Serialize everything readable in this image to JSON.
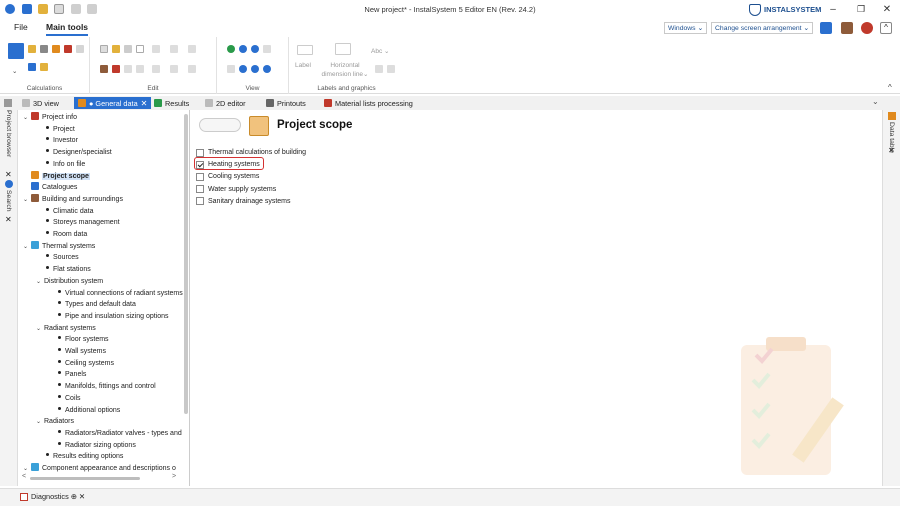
{
  "window": {
    "title": "New project* - InstalSystem 5 Editor EN (Rev. 24.2)",
    "brand": "INSTALSYSTEM",
    "minimize": "–",
    "restore": "❐",
    "close": "✕"
  },
  "menu": {
    "file": "File",
    "main_tools": "Main tools",
    "windows_select": "Windows ⌄",
    "arrangement_select": "Change screen arrangement ⌄"
  },
  "ribbon": {
    "groups": {
      "calculations": "Calculations",
      "edit": "Edit",
      "view": "View",
      "labels_graphics": "Labels and graphics"
    },
    "label_button": "Label",
    "horizontal_line_1": "Horizontal",
    "horizontal_line_2": "dimension line⌄",
    "abc": "Abc ⌄"
  },
  "tabs": [
    {
      "label": "3D view"
    },
    {
      "label": "● General data"
    },
    {
      "label": "Results"
    },
    {
      "label": "2D editor"
    },
    {
      "label": "Printouts"
    },
    {
      "label": "Material lists processing"
    }
  ],
  "side": {
    "left_1": "Project browser",
    "left_2": "Search",
    "right_1": "Data table"
  },
  "tree": [
    {
      "label": "Project info",
      "level": 0,
      "arrow": "⌄",
      "icon": "#c0392b"
    },
    {
      "label": "Project",
      "level": 1,
      "bullet": true
    },
    {
      "label": "Investor",
      "level": 1,
      "bullet": true
    },
    {
      "label": "Designer/specialist",
      "level": 1,
      "bullet": true
    },
    {
      "label": "Info on file",
      "level": 1,
      "bullet": true
    },
    {
      "label": "Project scope",
      "level": 0,
      "selected": true,
      "icon": "#e08a1e"
    },
    {
      "label": "Catalogues",
      "level": 0,
      "icon": "#2a6fcf"
    },
    {
      "label": "Building and surroundings",
      "level": 0,
      "arrow": "⌄",
      "icon": "#8e5b3a"
    },
    {
      "label": "Climatic data",
      "level": 1,
      "bullet": true
    },
    {
      "label": "Storeys management",
      "level": 1,
      "bullet": true
    },
    {
      "label": "Room data",
      "level": 1,
      "bullet": true
    },
    {
      "label": "Thermal systems",
      "level": 0,
      "arrow": "⌄",
      "icon": "#3aa0d8"
    },
    {
      "label": "Sources",
      "level": 1,
      "bullet": true
    },
    {
      "label": "Flat stations",
      "level": 1,
      "bullet": true
    },
    {
      "label": "Distribution system",
      "level": 1,
      "arrow": "⌄"
    },
    {
      "label": "Virtual connections of radiant systems",
      "level": 2,
      "bullet": true
    },
    {
      "label": "Types and default data",
      "level": 2,
      "bullet": true
    },
    {
      "label": "Pipe and insulation sizing options",
      "level": 2,
      "bullet": true
    },
    {
      "label": "Radiant systems",
      "level": 1,
      "arrow": "⌄"
    },
    {
      "label": "Floor systems",
      "level": 2,
      "bullet": true
    },
    {
      "label": "Wall systems",
      "level": 2,
      "bullet": true
    },
    {
      "label": "Ceiling systems",
      "level": 2,
      "bullet": true
    },
    {
      "label": "Panels",
      "level": 2,
      "bullet": true
    },
    {
      "label": "Manifolds, fittings and control",
      "level": 2,
      "bullet": true
    },
    {
      "label": "Coils",
      "level": 2,
      "bullet": true
    },
    {
      "label": "Additional options",
      "level": 2,
      "bullet": true
    },
    {
      "label": "Radiators",
      "level": 1,
      "arrow": "⌄"
    },
    {
      "label": "Radiators/Radiator valves - types and",
      "level": 2,
      "bullet": true
    },
    {
      "label": "Radiator sizing options",
      "level": 2,
      "bullet": true
    },
    {
      "label": "Results editing options",
      "level": 1,
      "bullet": true
    },
    {
      "label": "Component appearance and descriptions o",
      "level": 0,
      "arrow": "⌄",
      "icon": "#3aa0d8"
    }
  ],
  "main": {
    "title": "Project scope",
    "options": [
      {
        "label": "Thermal calculations of building",
        "checked": false
      },
      {
        "label": "Heating systems",
        "checked": true
      },
      {
        "label": "Cooling systems",
        "checked": false
      },
      {
        "label": "Water supply systems",
        "checked": false
      },
      {
        "label": "Sanitary drainage systems",
        "checked": false
      }
    ]
  },
  "bottom": {
    "diagnostics": "Diagnostics ⊕ ✕"
  },
  "colors": {
    "accent": "#2a6fcf",
    "highlight": "#d43232",
    "selected_bg": "#d3e3f7"
  }
}
